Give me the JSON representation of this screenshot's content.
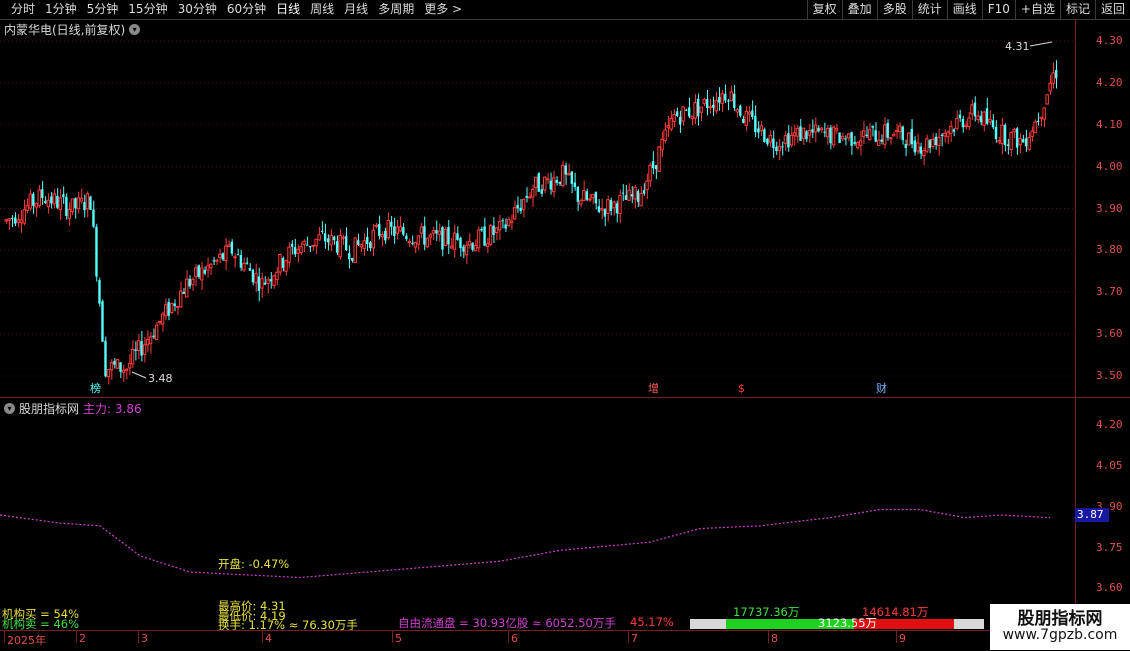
{
  "toolbar": {
    "timeframes": [
      "分时",
      "1分钟",
      "5分钟",
      "15分钟",
      "30分钟",
      "60分钟",
      "日线",
      "周线",
      "月线",
      "多周期",
      "更多 >"
    ],
    "active_timeframe": "日线",
    "buttons": [
      "复权",
      "叠加",
      "多股",
      "统计",
      "画线",
      "F10",
      "+自选",
      "标记",
      "返回"
    ]
  },
  "stock": {
    "title": "内蒙华电(日线,前复权)"
  },
  "colors": {
    "up": "#ff3b3b",
    "down": "#54ffff",
    "axis": "#e05050",
    "magenta": "#d040d0",
    "yellow": "#e8e040",
    "green": "#40e040"
  },
  "main_chart": {
    "price_ticks": [
      "4.30",
      "4.20",
      "4.10",
      "4.00",
      "3.90",
      "3.80",
      "3.70",
      "3.60",
      "3.50"
    ],
    "high_label": "4.31",
    "low_label": "3.48",
    "event_flags": [
      {
        "text": "榜",
        "color": "#54ffff"
      },
      {
        "text": "增",
        "color": "#ff6060"
      },
      {
        "text": "$",
        "color": "#ff3b3b"
      },
      {
        "text": "财",
        "color": "#7fb0ff"
      }
    ]
  },
  "indicator": {
    "name": "股朋指标网",
    "main_label": "主力: 3.86",
    "ticks": [
      "4.20",
      "4.05",
      "3.90",
      "3.75",
      "3.60"
    ],
    "current": "3.87",
    "open_label": "开盘: -0.47%"
  },
  "bottom": {
    "inst_buy": "机构买 = 54%",
    "inst_sell": "机构卖 = 46%",
    "high_price": "最高价: 4.31",
    "low_price": "最低价: 4.19",
    "turnover": "换手: 1.17% ≈ 76.30万手",
    "free_float": "自由流通盘 = 30.93亿股 ≈ 6052.50万手",
    "pct": "45.17%",
    "buy_vol": "17737.36万",
    "sell_vol": "14614.81万",
    "mid_vol": "3123.55万"
  },
  "date_axis": [
    "2025年",
    "2",
    "3",
    "4",
    "5",
    "6",
    "7",
    "8",
    "9"
  ],
  "watermark": {
    "line1": "股朋指标网",
    "line2": "www.7gpzb.com"
  }
}
